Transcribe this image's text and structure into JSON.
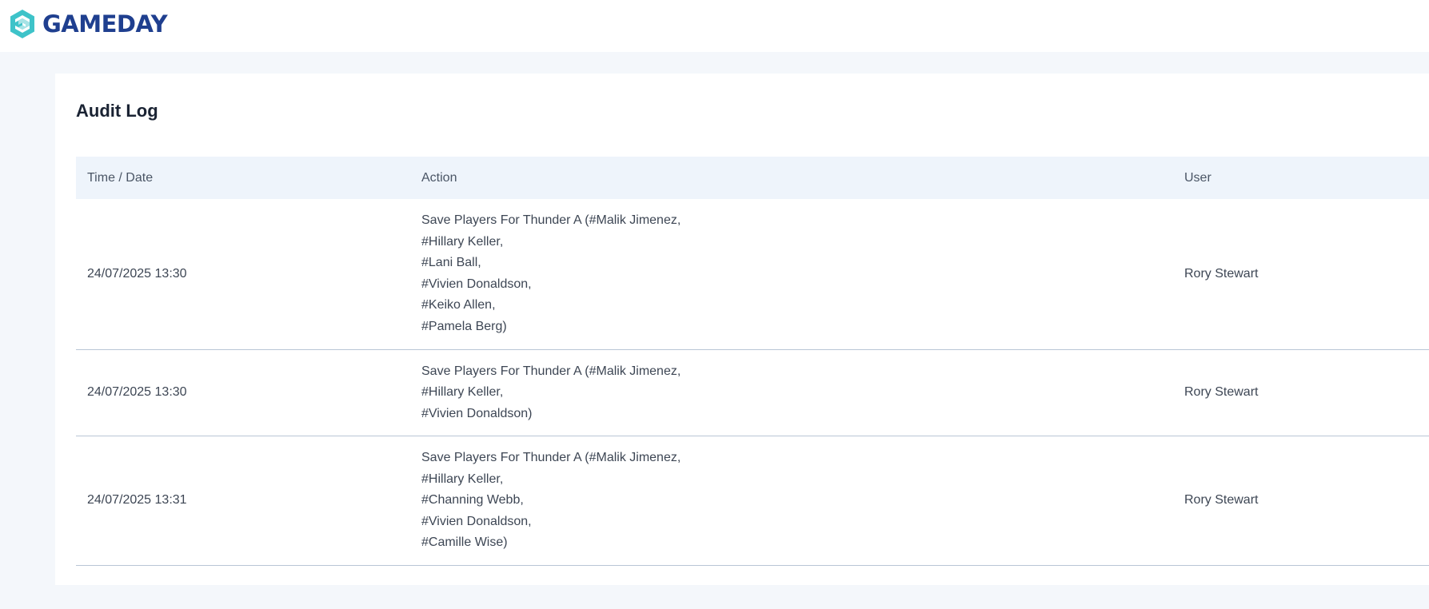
{
  "brand": {
    "name": "GAMEDAY",
    "logo_icon": "gameday-g-logo-icon",
    "colors": {
      "brand_text": "#1f3f8f",
      "logo_teal": "#3ec3c9",
      "logo_light": "#a6e3e6"
    }
  },
  "page": {
    "title": "Audit Log"
  },
  "table": {
    "columns": [
      "Time / Date",
      "Action",
      "User"
    ],
    "rows": [
      {
        "date": "24/07/2025 13:30",
        "action_lines": [
          "Save Players For Thunder A (#Malik Jimenez,",
          "#Hillary Keller,",
          "#Lani Ball,",
          "#Vivien Donaldson,",
          "#Keiko Allen,",
          "#Pamela Berg)"
        ],
        "user": "Rory Stewart"
      },
      {
        "date": "24/07/2025 13:30",
        "action_lines": [
          "Save Players For Thunder A (#Malik Jimenez,",
          "#Hillary Keller,",
          "#Vivien Donaldson)"
        ],
        "user": "Rory Stewart"
      },
      {
        "date": "24/07/2025 13:31",
        "action_lines": [
          "Save Players For Thunder A (#Malik Jimenez,",
          "#Hillary Keller,",
          "#Channing Webb,",
          "#Vivien Donaldson,",
          "#Camille Wise)"
        ],
        "user": "Rory Stewart"
      }
    ]
  }
}
